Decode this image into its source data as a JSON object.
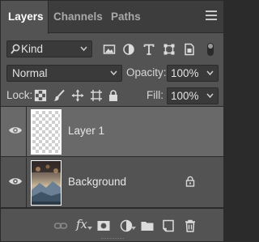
{
  "tabs": [
    {
      "label": "Layers",
      "active": true
    },
    {
      "label": "Channels",
      "active": false
    },
    {
      "label": "Paths",
      "active": false
    }
  ],
  "filter": {
    "kind_label": "Kind",
    "icons": [
      "pixel-filter-icon",
      "adjustment-filter-icon",
      "type-filter-icon",
      "shape-filter-icon",
      "smart-object-filter-icon"
    ]
  },
  "blend": {
    "mode": "Normal",
    "opacity_label": "Opacity:",
    "opacity_value": "100%"
  },
  "lock": {
    "label": "Lock:",
    "icons": [
      "lock-transparent-pixels-icon",
      "lock-image-pixels-icon",
      "lock-position-icon",
      "lock-artboard-icon",
      "lock-all-icon"
    ],
    "fill_label": "Fill:",
    "fill_value": "100%"
  },
  "layers": [
    {
      "name": "Layer 1",
      "selected": true,
      "visible": true,
      "locked": false
    },
    {
      "name": "Background",
      "selected": false,
      "visible": true,
      "locked": true
    }
  ],
  "bottom_icons": [
    "link-layers-icon",
    "layer-style-icon",
    "add-mask-icon",
    "adjustment-layer-icon",
    "new-group-icon",
    "new-layer-icon",
    "delete-layer-icon"
  ],
  "bottom_fx_label": "fx",
  "colors": {
    "panel_bg": "#535353",
    "tab_bar_bg": "#3d3d3d",
    "field_bg": "#3a3a3a",
    "selected_row": "#696969"
  }
}
